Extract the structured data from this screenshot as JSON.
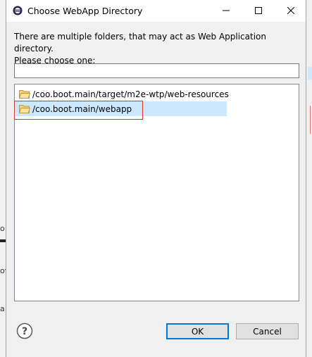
{
  "dialog": {
    "title": "Choose WebApp Directory",
    "message_line1": "There are multiple folders, that may act as Web Application directory.",
    "message_line2": "Please choose one:",
    "filter": {
      "value": "",
      "placeholder": ""
    },
    "folders": [
      {
        "label": "/coo.boot.main/target/m2e-wtp/web-resources",
        "selected": false
      },
      {
        "label": "/coo.boot.main/webapp",
        "selected": true
      }
    ],
    "buttons": {
      "ok": "OK",
      "cancel": "Cancel"
    },
    "help_icon": "question-circle-icon"
  },
  "background": {
    "left_frag_1": "o",
    "left_frag_2": "ov",
    "left_frag_3": "a"
  },
  "colors": {
    "selection": "#cce8ff",
    "highlight_box": "#e03030",
    "default_button_border": "#0078d7",
    "folder_icon": "#e8b74a"
  }
}
